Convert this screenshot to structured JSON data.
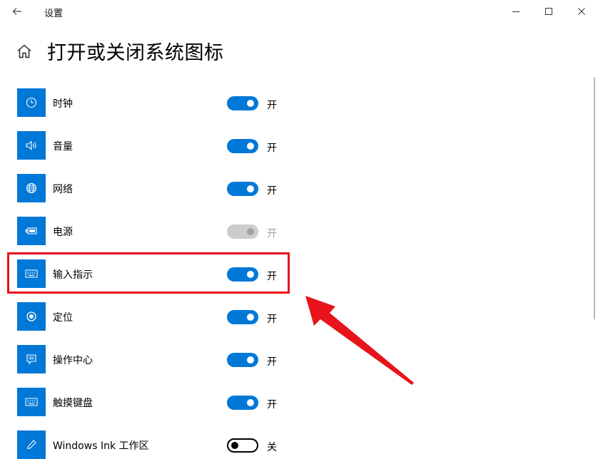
{
  "window": {
    "title": "设置"
  },
  "page": {
    "title": "打开或关闭系统图标"
  },
  "items": [
    {
      "label": "时钟",
      "icon": "clock-icon",
      "state": "开",
      "toggle": "on"
    },
    {
      "label": "音量",
      "icon": "volume-icon",
      "state": "开",
      "toggle": "on"
    },
    {
      "label": "网络",
      "icon": "globe-icon",
      "state": "开",
      "toggle": "on"
    },
    {
      "label": "电源",
      "icon": "battery-icon",
      "state": "开",
      "toggle": "disabled"
    },
    {
      "label": "输入指示",
      "icon": "keyboard-icon",
      "state": "开",
      "toggle": "on"
    },
    {
      "label": "定位",
      "icon": "location-icon",
      "state": "开",
      "toggle": "on"
    },
    {
      "label": "操作中心",
      "icon": "action-center-icon",
      "state": "开",
      "toggle": "on"
    },
    {
      "label": "触摸键盘",
      "icon": "keyboard-icon",
      "state": "开",
      "toggle": "on"
    },
    {
      "label": "Windows Ink 工作区",
      "icon": "pen-icon",
      "state": "关",
      "toggle": "off"
    }
  ],
  "colors": {
    "accent": "#0078d7",
    "annotation": "#e8141b"
  }
}
